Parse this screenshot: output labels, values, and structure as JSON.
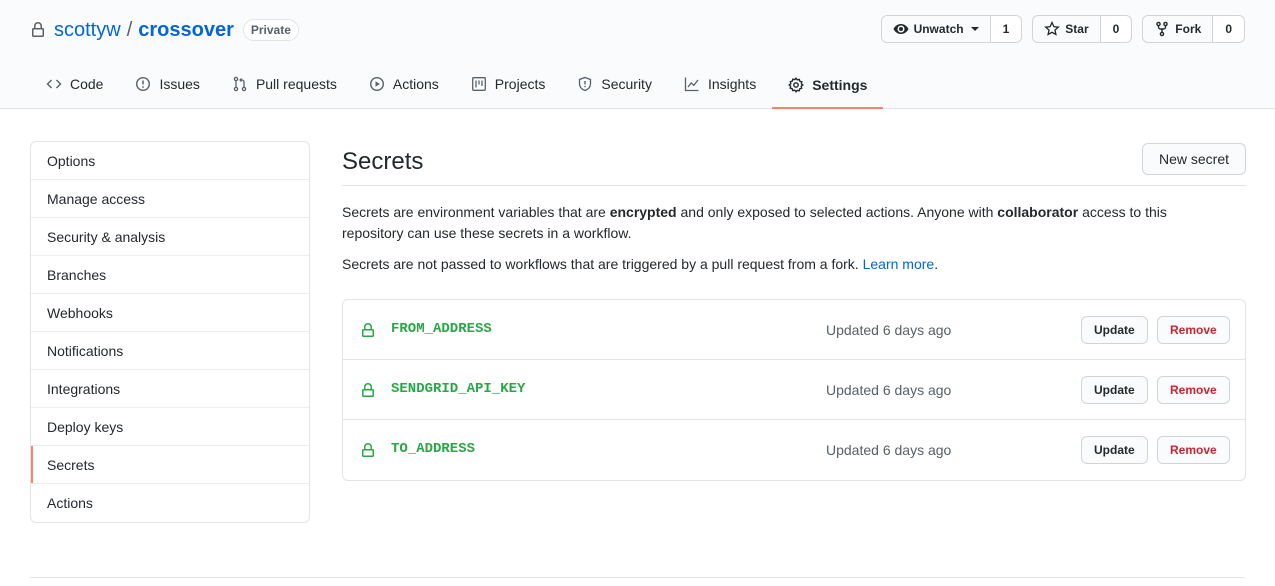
{
  "repo": {
    "owner": "scottyw",
    "separator": "/",
    "name": "crossover",
    "visibility": "Private"
  },
  "actions": {
    "watch": {
      "label": "Unwatch",
      "count": "1"
    },
    "star": {
      "label": "Star",
      "count": "0"
    },
    "fork": {
      "label": "Fork",
      "count": "0"
    }
  },
  "nav": {
    "tabs": [
      {
        "label": "Code",
        "icon": "code-icon"
      },
      {
        "label": "Issues",
        "icon": "issue-icon"
      },
      {
        "label": "Pull requests",
        "icon": "pull-request-icon"
      },
      {
        "label": "Actions",
        "icon": "play-icon"
      },
      {
        "label": "Projects",
        "icon": "project-icon"
      },
      {
        "label": "Security",
        "icon": "shield-icon"
      },
      {
        "label": "Insights",
        "icon": "graph-icon"
      },
      {
        "label": "Settings",
        "icon": "gear-icon",
        "selected": true
      }
    ]
  },
  "sidebar": {
    "items": [
      {
        "label": "Options"
      },
      {
        "label": "Manage access"
      },
      {
        "label": "Security & analysis"
      },
      {
        "label": "Branches"
      },
      {
        "label": "Webhooks"
      },
      {
        "label": "Notifications"
      },
      {
        "label": "Integrations"
      },
      {
        "label": "Deploy keys"
      },
      {
        "label": "Secrets",
        "selected": true
      },
      {
        "label": "Actions"
      }
    ]
  },
  "main": {
    "title": "Secrets",
    "new_button": "New secret",
    "desc": {
      "part1": "Secrets are environment variables that are ",
      "bold1": "encrypted",
      "part2": " and only exposed to selected actions. Anyone with ",
      "bold2": "collaborator",
      "part3": " access to this repository can use these secrets in a workflow."
    },
    "desc2": {
      "text": "Secrets are not passed to workflows that are triggered by a pull request from a fork. ",
      "link": "Learn more",
      "end": "."
    },
    "secrets": [
      {
        "name": "FROM_ADDRESS",
        "updated": "Updated 6 days ago",
        "update_label": "Update",
        "remove_label": "Remove"
      },
      {
        "name": "SENDGRID_API_KEY",
        "updated": "Updated 6 days ago",
        "update_label": "Update",
        "remove_label": "Remove"
      },
      {
        "name": "TO_ADDRESS",
        "updated": "Updated 6 days ago",
        "update_label": "Update",
        "remove_label": "Remove"
      }
    ]
  },
  "colors": {
    "accent": "#f9826c",
    "link": "#0366d6",
    "secret_green": "#28a745",
    "danger": "#cb2431"
  }
}
